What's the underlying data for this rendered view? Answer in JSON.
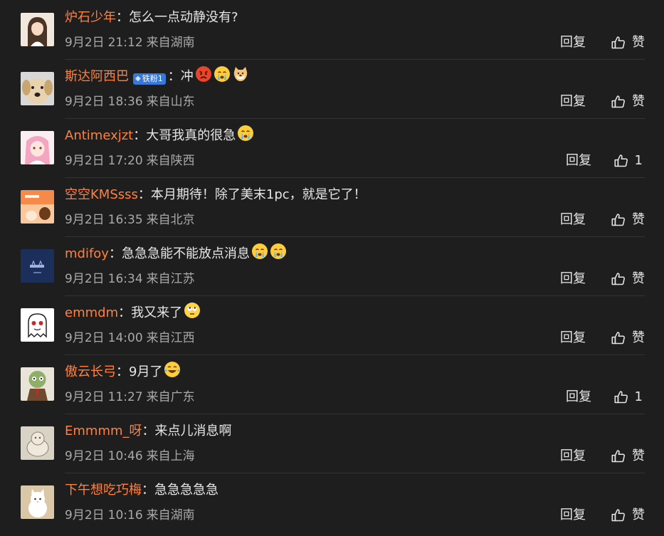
{
  "colors": {
    "background": "#1e1e1e",
    "username": "#ff8140",
    "meta": "#a9a9a9",
    "divider": "#333333",
    "badge": "#3a78d8"
  },
  "actions": {
    "reply_label": "回复",
    "like_label": "赞",
    "colon": "："
  },
  "comments": [
    {
      "user": "炉石少年",
      "text": "怎么一点动静没有?",
      "emojis": [],
      "date": "9月2日",
      "time": "21:12",
      "location": "来自湖南",
      "likes": "赞",
      "avatar": "girl"
    },
    {
      "user": "斯达阿西巴",
      "badge": "铁粉1",
      "text": "冲",
      "emojis": [
        "angry-face-icon",
        "crying-face-icon",
        "doge-icon"
      ],
      "date": "9月2日",
      "time": "18:36",
      "location": "来自山东",
      "likes": "赞",
      "avatar": "dog"
    },
    {
      "user": "Antimexjzt",
      "text": "大哥我真的很急",
      "emojis": [
        "crying-face-icon"
      ],
      "date": "9月2日",
      "time": "17:20",
      "location": "来自陕西",
      "likes": "1",
      "avatar": "anime-pink"
    },
    {
      "user": "空空KMSsss",
      "text": "本月期待！除了美末1pc，就是它了！",
      "emojis": [],
      "date": "9月2日",
      "time": "16:35",
      "location": "来自北京",
      "likes": "赞",
      "avatar": "orange-card"
    },
    {
      "user": "mdifoy",
      "text": "急急急能不能放点消息",
      "emojis": [
        "crying-face-icon",
        "crying-face-icon"
      ],
      "date": "9月2日",
      "time": "16:34",
      "location": "来自江苏",
      "likes": "赞",
      "avatar": "navy-square"
    },
    {
      "user": "emmdm",
      "text": "我又来了",
      "emojis": [
        "rolling-eyes-icon"
      ],
      "date": "9月2日",
      "time": "14:00",
      "location": "来自江西",
      "likes": "赞",
      "avatar": "white-ghost"
    },
    {
      "user": "傲云长弓",
      "text": "9月了",
      "emojis": [
        "laughing-crying-icon"
      ],
      "date": "9月2日",
      "time": "11:27",
      "location": "来自广东",
      "likes": "1",
      "avatar": "zombie"
    },
    {
      "user": "Emmmm_呀",
      "text": "来点儿消息啊",
      "emojis": [],
      "date": "9月2日",
      "time": "10:46",
      "location": "来自上海",
      "likes": "赞",
      "avatar": "sketch-cat"
    },
    {
      "user": "下午想吃巧梅",
      "text": "急急急急急",
      "emojis": [],
      "date": "9月2日",
      "time": "10:16",
      "location": "来自湖南",
      "likes": "赞",
      "avatar": "white-cat"
    }
  ]
}
